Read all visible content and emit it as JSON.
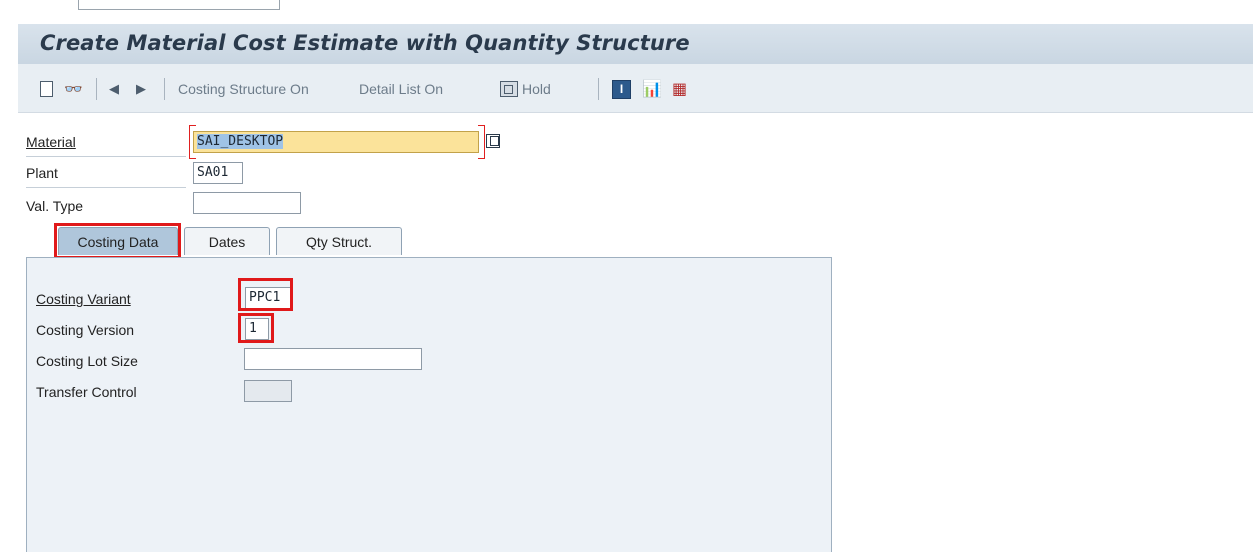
{
  "window": {
    "title": "Create Material Cost Estimate with Quantity Structure"
  },
  "toolbar": {
    "new_icon": "document-icon",
    "other_icon": "glasses-icon",
    "prev_icon": "triangle-left-icon",
    "next_icon": "triangle-right-icon",
    "costing_structure": "Costing Structure On",
    "detail_list": "Detail List On",
    "hold": "Hold",
    "info_icon": "info-icon",
    "info_glyph": "I",
    "chart_icon": "chart-icon",
    "grid_icon": "grid-icon"
  },
  "form": {
    "material_label": "Material",
    "material_value": "SAI_DESKTOP",
    "plant_label": "Plant",
    "plant_value": "SA01",
    "valtype_label": "Val. Type",
    "valtype_value": ""
  },
  "tabs": [
    {
      "label": "Costing Data",
      "active": true
    },
    {
      "label": "Dates",
      "active": false
    },
    {
      "label": "Qty Struct.",
      "active": false
    }
  ],
  "costing_data": {
    "variant_label": "Costing Variant",
    "variant_value": "PPC1",
    "version_label": "Costing Version",
    "version_value": "1",
    "lot_size_label": "Costing Lot Size",
    "lot_size_value": "",
    "transfer_label": "Transfer Control",
    "transfer_value": ""
  },
  "colors": {
    "highlight": "#e0191a",
    "required_field": "#fbe39a",
    "active_tab": "#afc6db",
    "panel": "#edf2f7"
  }
}
